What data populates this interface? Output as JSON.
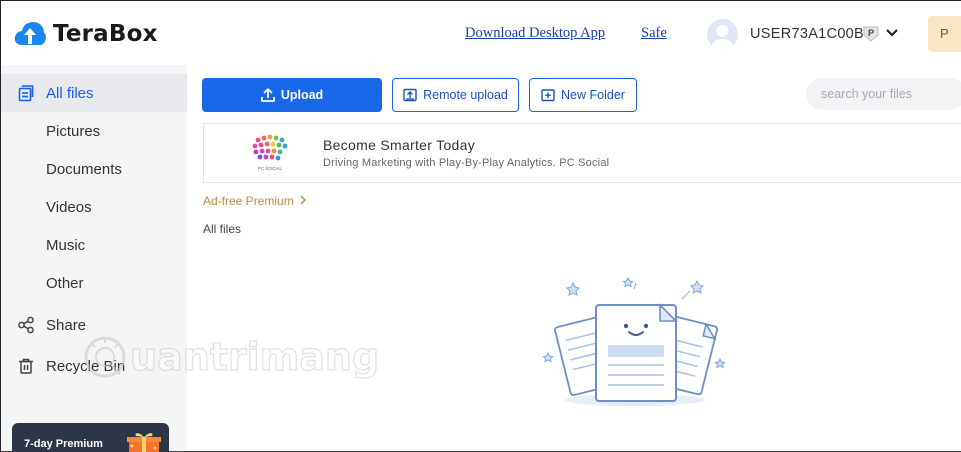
{
  "header": {
    "brand": "TeraBox",
    "download_link": "Download Desktop App",
    "safe_link": "Safe",
    "username": "USER73A1C00B",
    "badge_letter": "P",
    "premium_tab": "P"
  },
  "sidebar": {
    "items": [
      {
        "label": "All files",
        "icon": "files-icon",
        "active": true
      },
      {
        "label": "Pictures"
      },
      {
        "label": "Documents"
      },
      {
        "label": "Videos"
      },
      {
        "label": "Music"
      },
      {
        "label": "Other"
      },
      {
        "label": "Share",
        "icon": "share-icon"
      },
      {
        "label": "Recycle Bin",
        "icon": "trash-icon"
      }
    ],
    "promo": "7-day Premium"
  },
  "toolbar": {
    "upload": "Upload",
    "remote_upload": "Remote upload",
    "new_folder": "New Folder",
    "search_placeholder": "search your files"
  },
  "ad": {
    "logo_caption": "PC SOCIAL",
    "title": "Become Smarter Today",
    "subtitle": "Driving Marketing with Play-By-Play Analytics. PC Social"
  },
  "adfree": "Ad-free Premium",
  "breadcrumb": "All files",
  "watermark": "uantrimang",
  "colors": {
    "accent": "#1868e9",
    "sidebar_bg": "#f4f5f6",
    "active_bg": "#e7e9ec",
    "premium_gold": "#c28a3e"
  }
}
